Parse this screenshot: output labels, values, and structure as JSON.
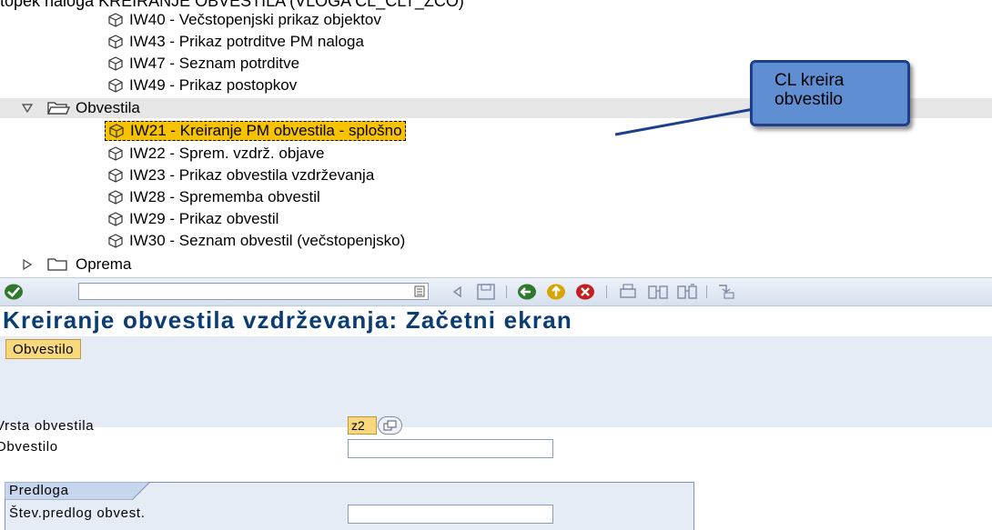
{
  "caption": "topek naloga KREIRANJE OBVESTILA  (VLOGA CL_CLT_ZCO)",
  "tree": {
    "items_before": [
      {
        "label": "IW40 - Večstopenjski prikaz objektov"
      },
      {
        "label": "IW43 - Prikaz potrditve PM naloga"
      },
      {
        "label": "IW47 - Seznam potrditve"
      },
      {
        "label": "IW49 - Prikaz postopkov"
      }
    ],
    "open_folder": {
      "label": "Obvestila"
    },
    "selected_item": {
      "label": "IW21 - Kreiranje PM obvestila - splošno"
    },
    "items_after": [
      {
        "label": "IW22 - Sprem. vzdrž. objave"
      },
      {
        "label": "IW23 - Prikaz obvestila vzdrževanja"
      },
      {
        "label": "IW28 - Sprememba obvestil"
      },
      {
        "label": "IW29 - Prikaz obvestil"
      },
      {
        "label": "IW30 - Seznam obvestil (večstopenjsko)"
      }
    ],
    "closed_folder": {
      "label": "Oprema"
    }
  },
  "callout": {
    "line1": "CL kreira",
    "line2": "obvestilo"
  },
  "screen": {
    "title": "Kreiranje obvestila vzdrževanja: Začetni ekran",
    "app_button": "Obvestilo",
    "fields": {
      "notification_type_label": "Vrsta obvestila",
      "notification_type_value": "z2",
      "notification_label": "Obvestilo",
      "notification_value": "",
      "template_group_title": "Predloga",
      "template_label": "Štev.predlog obvest.",
      "template_value": ""
    }
  },
  "colors": {
    "title": "#0b3c73",
    "selection": "#f7c300",
    "callout_fill": "#5f8fd2",
    "callout_border": "#1d3f8c",
    "required_field": "#f7d87a"
  }
}
